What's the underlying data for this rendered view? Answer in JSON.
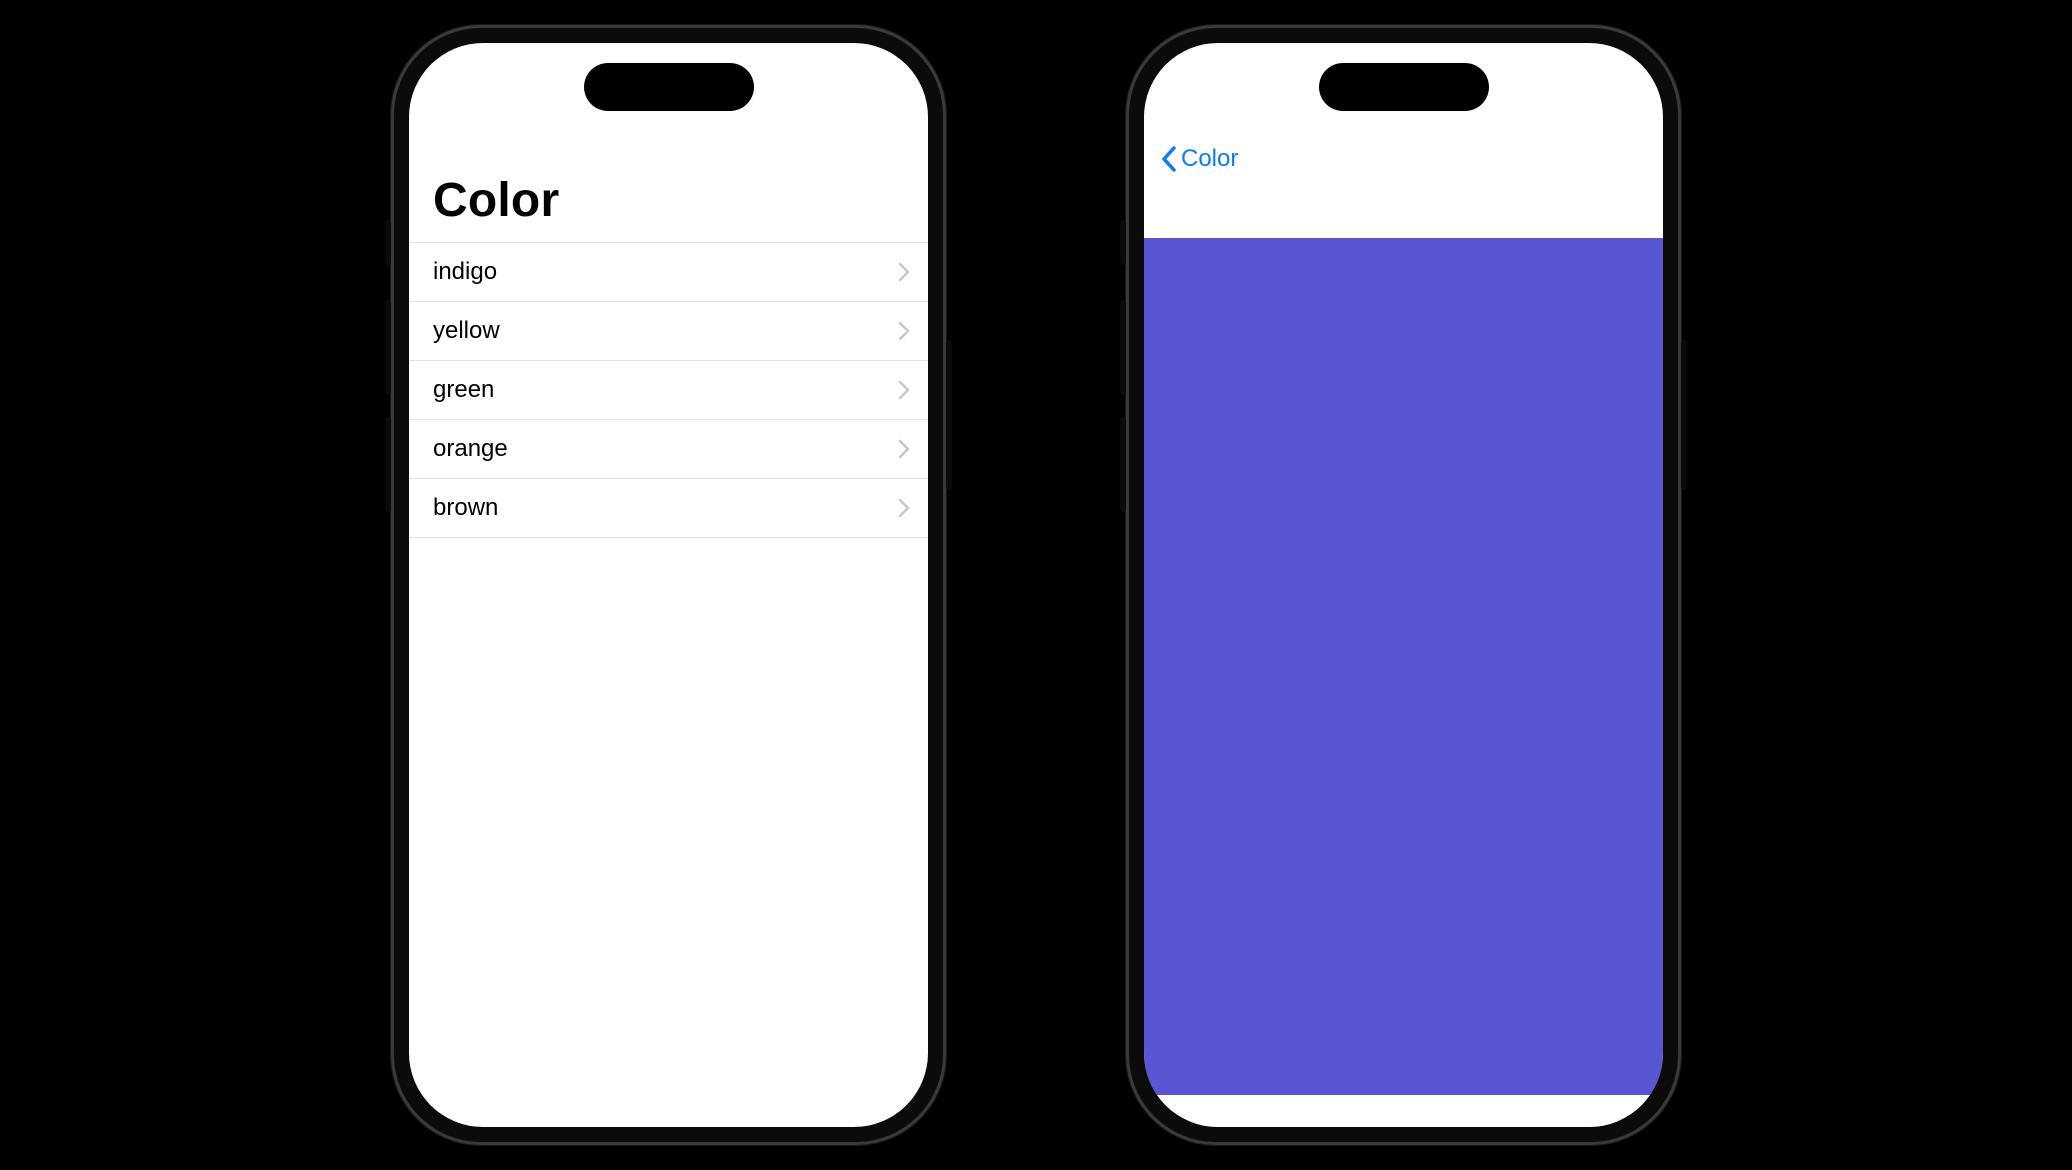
{
  "colors": {
    "ios_blue": "#0a7aff",
    "divider": "#e2e2e4",
    "detail_fill": "#5856d3"
  },
  "screen1": {
    "title": "Color",
    "items": [
      {
        "label": "indigo"
      },
      {
        "label": "yellow"
      },
      {
        "label": "green"
      },
      {
        "label": "orange"
      },
      {
        "label": "brown"
      }
    ]
  },
  "screen2": {
    "back_label": "Color"
  }
}
